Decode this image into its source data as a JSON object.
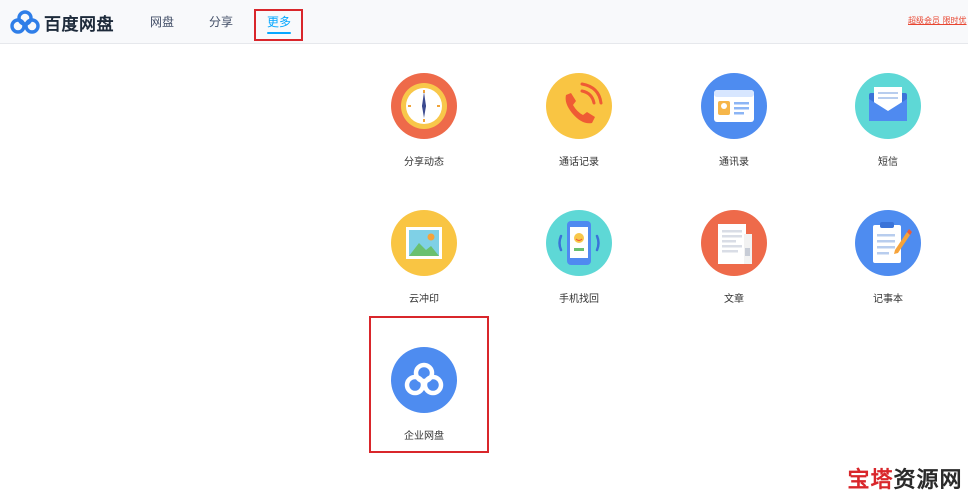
{
  "header": {
    "logo_text": "百度网盘",
    "nav": [
      {
        "label": "网盘",
        "active": false
      },
      {
        "label": "分享",
        "active": false
      },
      {
        "label": "更多",
        "active": true
      }
    ],
    "promo_text": "超级会员 限时优",
    "accent_color": "#06a7ff",
    "highlight_color": "#d9262b"
  },
  "apps": [
    {
      "label": "分享动态",
      "icon": "clock-icon"
    },
    {
      "label": "通话记录",
      "icon": "phone-icon"
    },
    {
      "label": "通讯录",
      "icon": "contact-card-icon"
    },
    {
      "label": "短信",
      "icon": "envelope-icon"
    },
    {
      "label": "云冲印",
      "icon": "photo-icon"
    },
    {
      "label": "手机找回",
      "icon": "mobile-phone-icon"
    },
    {
      "label": "文章",
      "icon": "document-icon"
    },
    {
      "label": "记事本",
      "icon": "notepad-icon"
    },
    {
      "label": "企业网盘",
      "icon": "cloud-logo-icon"
    }
  ],
  "watermark": {
    "part1": "宝塔",
    "part2": "资源网"
  }
}
